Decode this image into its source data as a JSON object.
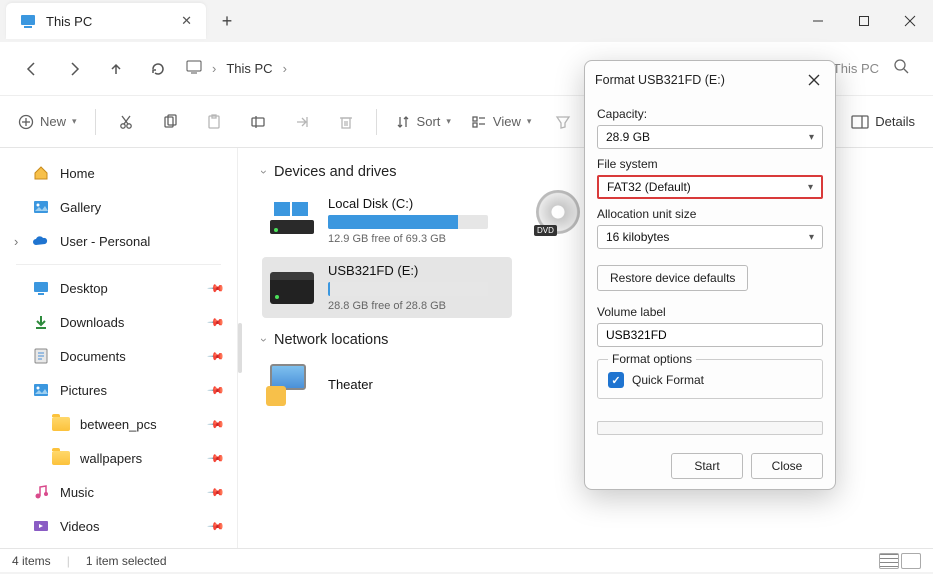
{
  "window": {
    "tab_title": "This PC"
  },
  "nav": {
    "breadcrumb": "This PC",
    "search_placeholder": "Search This PC"
  },
  "toolbar": {
    "new": "New",
    "sort": "Sort",
    "view": "View",
    "details": "Details"
  },
  "sidebar": {
    "home": "Home",
    "gallery": "Gallery",
    "user": "User - Personal",
    "desktop": "Desktop",
    "downloads": "Downloads",
    "documents": "Documents",
    "pictures": "Pictures",
    "between": "between_pcs",
    "wallpapers": "wallpapers",
    "music": "Music",
    "videos": "Videos"
  },
  "content": {
    "group1": "Devices and drives",
    "drive_c": {
      "name": "Local Disk (C:)",
      "free": "12.9 GB free of 69.3 GB",
      "fill_pct": 81
    },
    "drive_e": {
      "name": "USB321FD (E:)",
      "free": "28.8 GB free of 28.8 GB",
      "fill_pct": 1
    },
    "dvd_label": "DVD",
    "group2": "Network locations",
    "theater": "Theater"
  },
  "status": {
    "count": "4 items",
    "selected": "1 item selected"
  },
  "dialog": {
    "title": "Format USB321FD (E:)",
    "capacity_label": "Capacity:",
    "capacity_value": "28.9 GB",
    "fs_label": "File system",
    "fs_value": "FAT32 (Default)",
    "au_label": "Allocation unit size",
    "au_value": "16 kilobytes",
    "restore": "Restore device defaults",
    "vol_label": "Volume label",
    "vol_value": "USB321FD",
    "fmt_options": "Format options",
    "quick": "Quick Format",
    "start": "Start",
    "close": "Close"
  }
}
